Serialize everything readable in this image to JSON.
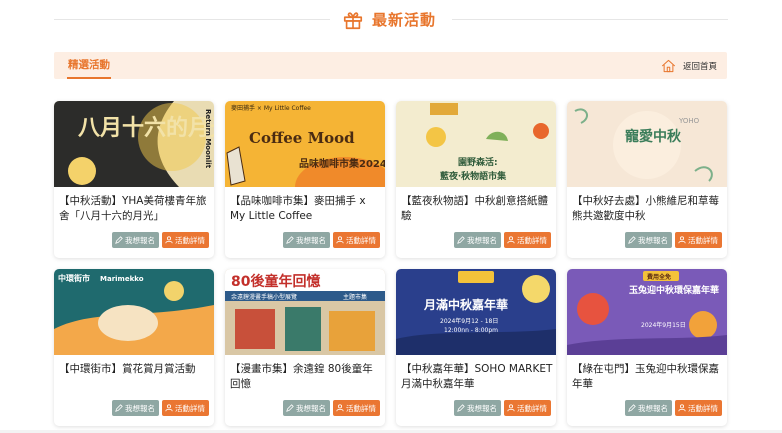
{
  "header": {
    "title": "最新活動",
    "icon": "gift-icon"
  },
  "section": {
    "tab_label": "精選活動",
    "home_label": "返回首頁",
    "home_icon": "home-icon"
  },
  "buttons": {
    "register": "我想報名",
    "details": "活動詳情"
  },
  "colors": {
    "accent": "#e8762d",
    "register_button": "#8fa7a3",
    "details_button": "#ea7632",
    "section_bg": "#fdeee3"
  },
  "cards": [
    {
      "title": "【中秋活動】YHA美荷樓青年旅舍「八月十六的月光」",
      "image_text": "八月十六的月光",
      "image_subtext": "Return Moonlit"
    },
    {
      "title": "【品味咖啡市集】麥田捕手 x My Little Coffee",
      "image_text": "品味咖啡市集2024",
      "image_subtext": "麥田捕手 × My Little Coffee",
      "image_text2": "Coffee Mood"
    },
    {
      "title": "【藍夜秋物語】中秋創意搭紙體驗",
      "image_text": "園野森活:",
      "image_subtext": "藍夜‧秋物語市集"
    },
    {
      "title": "【中秋好去處】小熊維尼和草莓熊共邀歡度中秋",
      "image_text": "寵愛中秋",
      "image_subtext": "YOHO"
    },
    {
      "title": "【中環街市】賞花賞月賞活動",
      "image_text": "中環街市",
      "image_subtext": "Marimekko"
    },
    {
      "title": "【漫畫市集】余遠鍠 80後童年回憶",
      "image_text": "80後童年回憶",
      "image_subtext": "余遠鍠漫畫手稿小型展覽",
      "image_text2": "主題市集"
    },
    {
      "title": "【中秋嘉年華】SOHO MARKET月滿中秋嘉年華",
      "image_text": "月滿中秋嘉年華",
      "image_subtext": "2024年9月12 - 18日",
      "image_text2": "12:00nn - 8:00pm"
    },
    {
      "title": "【綠在屯門】玉兔迎中秋環保嘉年華",
      "image_text": "玉兔迎中秋環保嘉年華",
      "image_subtext": "費用全免",
      "image_text2": "2024年9月15日"
    }
  ]
}
